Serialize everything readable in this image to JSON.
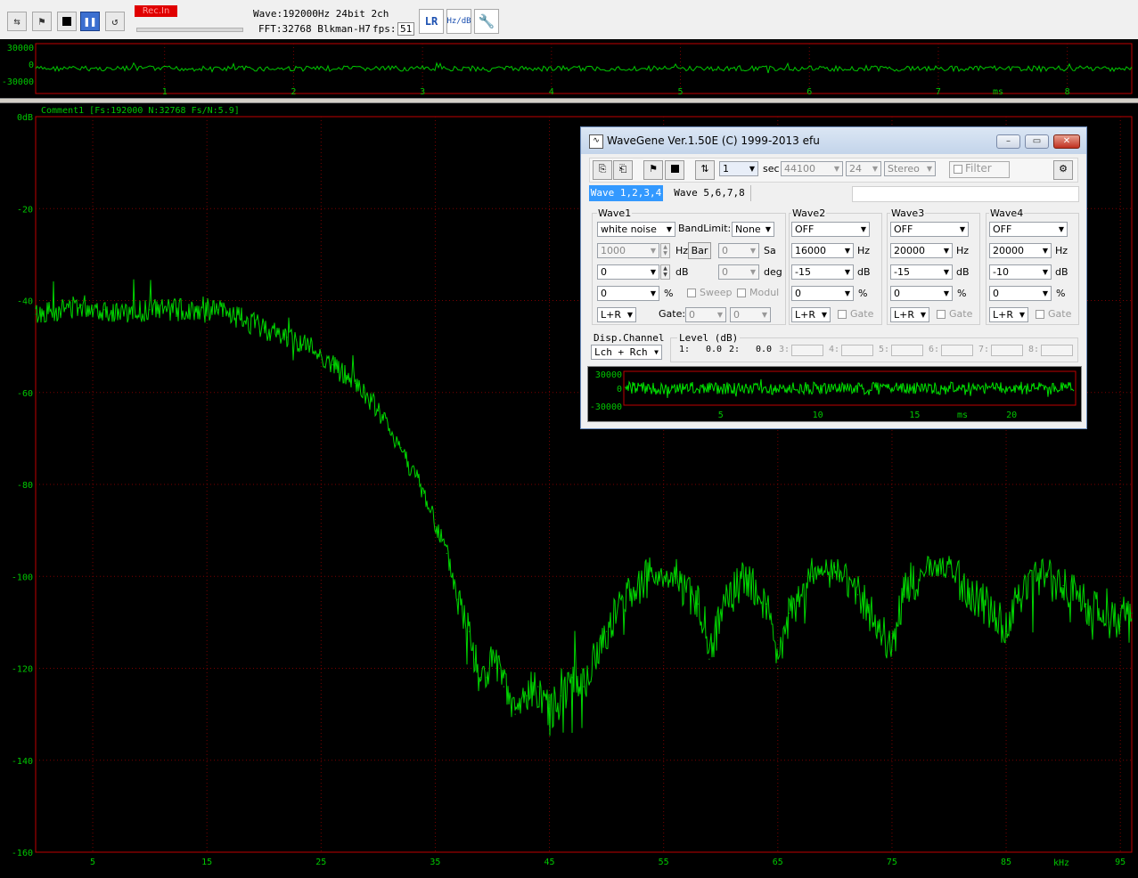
{
  "toolbar": {
    "rec_label": "Rec.In",
    "wave_info": "Wave:192000Hz 24bit 2ch",
    "fft_info": "FFT:32768 Blkman-H7",
    "fps_label": "fps:",
    "fps_value": "51",
    "icons": [
      "record-source-icon",
      "play-icon",
      "stop-icon",
      "pause-icon",
      "repeat-icon",
      "lr-channel-icon",
      "hz-db-scale-icon",
      "settings-wrench-icon"
    ]
  },
  "scope": {
    "y_labels": [
      "30000",
      "0",
      "-30000"
    ],
    "x_labels": [
      "1",
      "2",
      "3",
      "4",
      "5",
      "6",
      "7",
      "8"
    ],
    "unit": "ms",
    "trace_color": "#00c800"
  },
  "spectrum": {
    "header": "Comment1  [Fs:192000 N:32768 Fs/N:5.9]",
    "y_labels": [
      "0dB",
      "-20",
      "-40",
      "-60",
      "-80",
      "-100",
      "-120",
      "-140",
      "-160"
    ],
    "x_labels": [
      "5",
      "15",
      "25",
      "35",
      "45",
      "55",
      "65",
      "75",
      "85",
      "95"
    ],
    "x_unit": "kHz"
  },
  "chart_data": {
    "type": "line",
    "title": "",
    "xlabel": "kHz",
    "ylabel": "dB",
    "xlim": [
      0,
      96
    ],
    "ylim": [
      -160,
      0
    ],
    "grid": true,
    "series": [
      {
        "x": [
          0,
          2,
          4,
          6,
          8,
          10,
          12,
          14,
          16,
          18,
          20,
          22,
          24,
          26,
          28,
          30,
          32,
          34,
          36,
          37,
          38,
          38.5,
          39,
          39.5,
          40,
          41,
          42,
          43,
          44,
          45,
          46,
          47,
          48,
          50,
          52,
          54,
          56,
          58,
          59,
          60,
          62,
          64,
          65,
          66,
          68,
          70,
          72,
          74,
          75,
          76,
          78,
          80,
          82,
          84,
          85,
          86,
          88,
          90,
          92,
          94,
          96
        ],
        "y": [
          -43,
          -42,
          -41,
          -42,
          -43,
          -42,
          -42,
          -42,
          -42,
          -44,
          -46,
          -48,
          -50,
          -54,
          -58,
          -64,
          -72,
          -82,
          -95,
          -105,
          -112,
          -118,
          -122,
          -122,
          -118,
          -124,
          -130,
          -126,
          -124,
          -130,
          -126,
          -122,
          -124,
          -112,
          -103,
          -100,
          -100,
          -106,
          -118,
          -108,
          -100,
          -106,
          -120,
          -108,
          -100,
          -98,
          -104,
          -112,
          -116,
          -104,
          -98,
          -98,
          -104,
          -108,
          -112,
          -104,
          -100,
          -102,
          -106,
          -110,
          -108
        ]
      }
    ]
  },
  "wavegene": {
    "title": "WaveGene Ver.1.50E (C) 1999-2013 efu",
    "duration_value": "1",
    "duration_unit": "sec",
    "rate": "44100",
    "bits": "24",
    "channels": "Stereo",
    "filter_label": "Filter",
    "tabs": [
      "Wave 1,2,3,4",
      "Wave 5,6,7,8"
    ],
    "wave1": {
      "title": "Wave1",
      "type": "white noise",
      "bandlimit_label": "BandLimit:",
      "bandlimit": "None",
      "freq": "1000",
      "freq_unit": "Hz",
      "bar_label": "Bar",
      "sa_value": "0",
      "sa_unit": "Sa",
      "level": "0",
      "level_unit": "dB",
      "deg_value": "0",
      "deg_unit": "deg",
      "pct": "0",
      "pct_unit": "%",
      "sweep_label": "Sweep",
      "modul_label": "Modul",
      "channel": "L+R",
      "gate_label": "Gate:",
      "gate_a": "0",
      "gate_b": "0"
    },
    "waves": [
      {
        "title": "Wave2",
        "type": "OFF",
        "freq": "16000",
        "freq_unit": "Hz",
        "level": "-15",
        "level_unit": "dB",
        "pct": "0",
        "pct_unit": "%",
        "channel": "L+R",
        "gate_label": "Gate"
      },
      {
        "title": "Wave3",
        "type": "OFF",
        "freq": "20000",
        "freq_unit": "Hz",
        "level": "-15",
        "level_unit": "dB",
        "pct": "0",
        "pct_unit": "%",
        "channel": "L+R",
        "gate_label": "Gate"
      },
      {
        "title": "Wave4",
        "type": "OFF",
        "freq": "20000",
        "freq_unit": "Hz",
        "level": "-10",
        "level_unit": "dB",
        "pct": "0",
        "pct_unit": "%",
        "channel": "L+R",
        "gate_label": "Gate"
      }
    ],
    "disp_channel_label": "Disp.Channel",
    "disp_channel": "Lch + Rch",
    "level_label": "Level (dB)",
    "level_items": [
      {
        "n": "1:",
        "v": "0.0"
      },
      {
        "n": "2:",
        "v": "0.0"
      },
      {
        "n": "3:",
        "v": ""
      },
      {
        "n": "4:",
        "v": ""
      },
      {
        "n": "5:",
        "v": ""
      },
      {
        "n": "6:",
        "v": ""
      },
      {
        "n": "7:",
        "v": ""
      },
      {
        "n": "8:",
        "v": ""
      }
    ],
    "preview": {
      "y_labels": [
        "30000",
        "0",
        "-30000"
      ],
      "x_labels": [
        "5",
        "10",
        "15",
        "20"
      ],
      "unit": "ms"
    }
  }
}
